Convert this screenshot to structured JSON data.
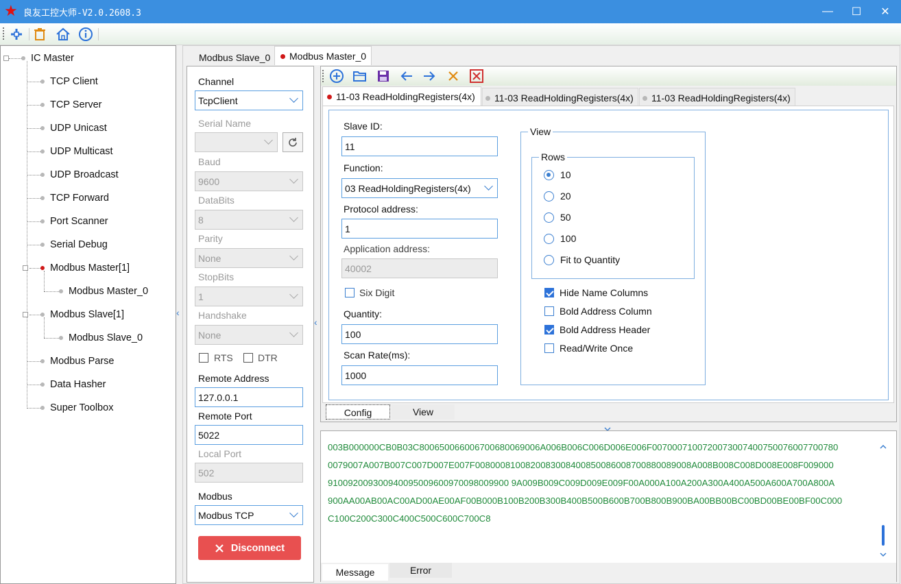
{
  "window": {
    "title": "良友工控大师-V2.0.2608.3",
    "minimize_glyph": "—",
    "maximize_glyph": "☐",
    "close_glyph": "✕"
  },
  "toolbar": {
    "icons": [
      "add-icon",
      "delete-icon",
      "home-icon",
      "info-icon"
    ]
  },
  "tree": {
    "root": "IC Master",
    "items": [
      "TCP Client",
      "TCP Server",
      "UDP Unicast",
      "UDP Multicast",
      "UDP Broadcast",
      "TCP Forward",
      "Port Scanner",
      "Serial Debug",
      "Modbus Master[1]",
      "Modbus Master_0",
      "Modbus Slave[1]",
      "Modbus Slave_0",
      "Modbus Parse",
      "Data Hasher",
      "Super Toolbox"
    ],
    "collapse_glyph": "‹"
  },
  "main_tabs": [
    "Modbus Slave_0",
    "Modbus Master_0"
  ],
  "channel": {
    "channel_label": "Channel",
    "channel_value": "TcpClient",
    "serial_name_label": "Serial Name",
    "serial_name_value": "",
    "baud_label": "Baud",
    "baud_value": "9600",
    "databits_label": "DataBits",
    "databits_value": "8",
    "parity_label": "Parity",
    "parity_value": "None",
    "stopbits_label": "StopBits",
    "stopbits_value": "1",
    "handshake_label": "Handshake",
    "handshake_value": "None",
    "rts_label": "RTS",
    "dtr_label": "DTR",
    "remote_address_label": "Remote Address",
    "remote_address_value": "127.0.0.1",
    "remote_port_label": "Remote Port",
    "remote_port_value": "5022",
    "local_port_label": "Local Port",
    "local_port_value": "502",
    "modbus_label": "Modbus",
    "modbus_value": "Modbus TCP",
    "disconnect_label": "Disconnect",
    "collapse_glyph": "‹"
  },
  "request_tabs": [
    "11-03 ReadHoldingRegisters(4x)",
    "11-03 ReadHoldingRegisters(4x)",
    "11-03 ReadHoldingRegisters(4x)"
  ],
  "config": {
    "slave_id_label": "Slave ID:",
    "slave_id_value": "11",
    "function_label": "Function:",
    "function_value": "03 ReadHoldingRegisters(4x)",
    "protocol_address_label": "Protocol address:",
    "protocol_address_value": "1",
    "application_address_label": "Application address:",
    "application_address_value": "40002",
    "six_digit_label": "Six Digit",
    "six_digit_checked": false,
    "quantity_label": "Quantity:",
    "quantity_value": "100",
    "scan_rate_label": "Scan Rate(ms):",
    "scan_rate_value": "1000"
  },
  "view": {
    "title": "View",
    "rows_title": "Rows",
    "rows_options": [
      "10",
      "20",
      "50",
      "100",
      "Fit to Quantity"
    ],
    "rows_selected": "10",
    "checks": [
      {
        "label": "Hide Name Columns",
        "checked": true
      },
      {
        "label": "Bold Address Column",
        "checked": false
      },
      {
        "label": "Bold Address Header",
        "checked": true
      },
      {
        "label": "Read/Write Once",
        "checked": false
      }
    ]
  },
  "bottom_tabs": [
    "Config",
    "View"
  ],
  "log": {
    "lines": [
      "003B000000CB0B03C800650066006700680069006A006B006C006D006E006F0070007100720073007400750076007700780",
      "0079007A007B007C007D007E007F0080008100820083008400850086008700880089008A008B008C008D008E008F009000",
      "910092009300940095009600970098009900 9A009B009C009D009E009F00A000A100A200A300A400A500A600A700A800A",
      "900AA00AB00AC00AD00AE00AF00B000B100B200B300B400B500B600B700B800B900BA00BB00BC00BD00BE00BF00C000",
      "C100C200C300C400C500C600C700C8"
    ],
    "tabs": [
      "Message",
      "Error"
    ],
    "color": "#1f8a3a"
  },
  "colors": {
    "titlebar": "#3b8fe0",
    "accent": "#3b7fd0",
    "disconnect": "#e85050",
    "active_dot": "#d01818"
  }
}
